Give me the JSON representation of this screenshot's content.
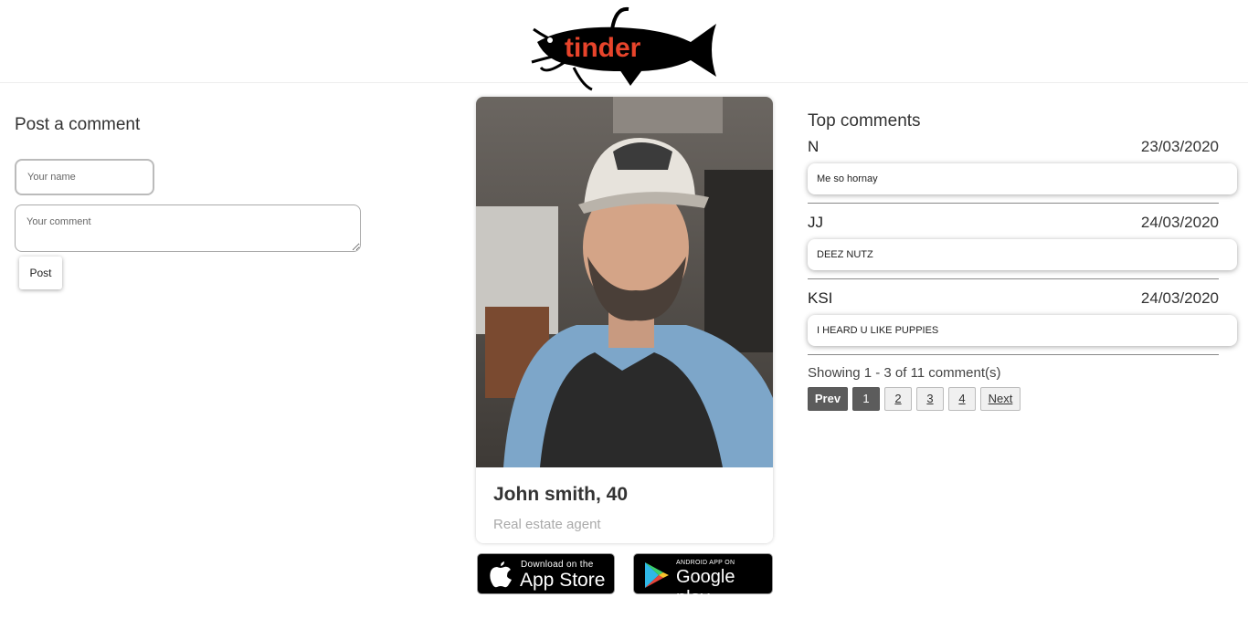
{
  "header": {
    "logo_text": "tinder"
  },
  "post_form": {
    "title": "Post a comment",
    "name_placeholder": "Your name",
    "name_value": "",
    "comment_placeholder": "Your comment",
    "comment_value": "",
    "post_label": "Post"
  },
  "profile": {
    "name": "John smith, 40",
    "job": "Real estate agent"
  },
  "stores": {
    "apple_small": "Download on the",
    "apple_big": "App Store",
    "google_small": "ANDROID APP ON",
    "google_big": "Google play"
  },
  "comments": {
    "title": "Top comments",
    "items": [
      {
        "author": "N",
        "date": "23/03/2020",
        "text": "Me so hornay"
      },
      {
        "author": "JJ",
        "date": "24/03/2020",
        "text": "DEEZ NUTZ"
      },
      {
        "author": "KSI",
        "date": "24/03/2020",
        "text": "I HEARD U LIKE PUPPIES"
      }
    ],
    "showing": "Showing 1 - 3 of 11 comment(s)",
    "pagination": {
      "prev": "Prev",
      "pages": [
        "1",
        "2",
        "3",
        "4"
      ],
      "next": "Next",
      "current": "1"
    }
  },
  "colors": {
    "logo_red": "#e8442b",
    "pager_dark": "#5c5c5c"
  }
}
